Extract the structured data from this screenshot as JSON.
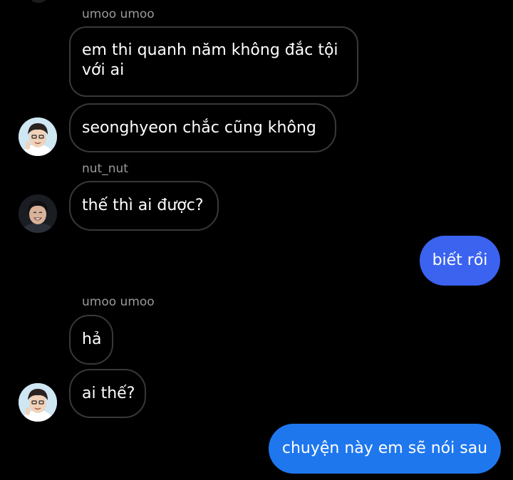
{
  "messages": {
    "m1_sender": "umoo umoo",
    "m1_text": "em thi quanh năm không đắc tội với ai",
    "m2_text": "seonghyeon chắc cũng không",
    "m3_sender": "nut_nut",
    "m3_text": "thế thì ai được?",
    "m4_text": "biết rồi",
    "m5_sender": "umoo umoo",
    "m5_text": "hả",
    "m6_text": "ai thế?",
    "m7_text": "chuyện này em sẽ nói sau"
  },
  "colors": {
    "background": "#000000",
    "incoming_border": "#383838",
    "sender_name": "#9a9a9a",
    "outgoing_bubble_a": "#3b63f0",
    "outgoing_bubble_b": "#1f77ee",
    "avatar_bg_light": "#cfe6f3",
    "avatar_bg_dark": "#1a1d22"
  },
  "icons": {
    "avatar_1": "profile-photo-icon",
    "avatar_2": "profile-photo-icon",
    "avatar_3": "profile-photo-icon"
  }
}
